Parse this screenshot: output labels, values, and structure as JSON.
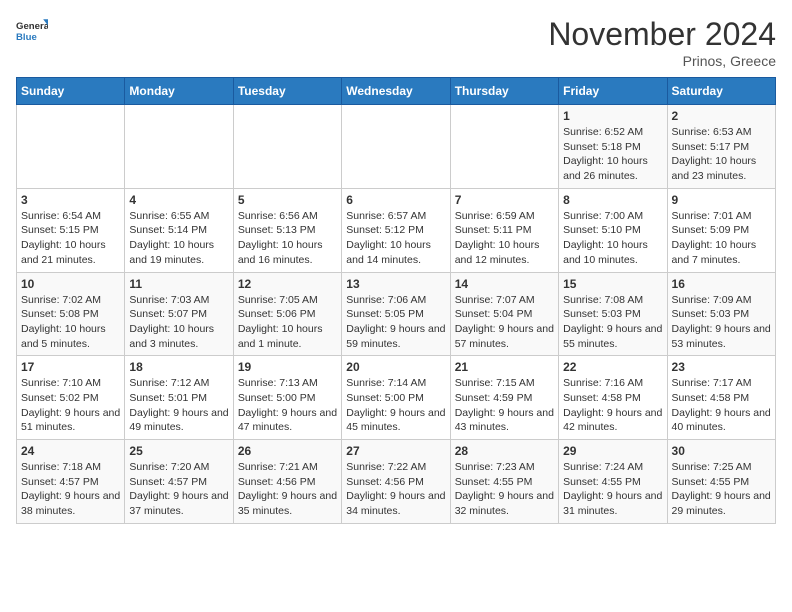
{
  "logo": {
    "line1": "General",
    "line2": "Blue"
  },
  "title": "November 2024",
  "subtitle": "Prinos, Greece",
  "days_of_week": [
    "Sunday",
    "Monday",
    "Tuesday",
    "Wednesday",
    "Thursday",
    "Friday",
    "Saturday"
  ],
  "weeks": [
    [
      {
        "day": "",
        "info": ""
      },
      {
        "day": "",
        "info": ""
      },
      {
        "day": "",
        "info": ""
      },
      {
        "day": "",
        "info": ""
      },
      {
        "day": "",
        "info": ""
      },
      {
        "day": "1",
        "info": "Sunrise: 6:52 AM\nSunset: 5:18 PM\nDaylight: 10 hours and 26 minutes."
      },
      {
        "day": "2",
        "info": "Sunrise: 6:53 AM\nSunset: 5:17 PM\nDaylight: 10 hours and 23 minutes."
      }
    ],
    [
      {
        "day": "3",
        "info": "Sunrise: 6:54 AM\nSunset: 5:15 PM\nDaylight: 10 hours and 21 minutes."
      },
      {
        "day": "4",
        "info": "Sunrise: 6:55 AM\nSunset: 5:14 PM\nDaylight: 10 hours and 19 minutes."
      },
      {
        "day": "5",
        "info": "Sunrise: 6:56 AM\nSunset: 5:13 PM\nDaylight: 10 hours and 16 minutes."
      },
      {
        "day": "6",
        "info": "Sunrise: 6:57 AM\nSunset: 5:12 PM\nDaylight: 10 hours and 14 minutes."
      },
      {
        "day": "7",
        "info": "Sunrise: 6:59 AM\nSunset: 5:11 PM\nDaylight: 10 hours and 12 minutes."
      },
      {
        "day": "8",
        "info": "Sunrise: 7:00 AM\nSunset: 5:10 PM\nDaylight: 10 hours and 10 minutes."
      },
      {
        "day": "9",
        "info": "Sunrise: 7:01 AM\nSunset: 5:09 PM\nDaylight: 10 hours and 7 minutes."
      }
    ],
    [
      {
        "day": "10",
        "info": "Sunrise: 7:02 AM\nSunset: 5:08 PM\nDaylight: 10 hours and 5 minutes."
      },
      {
        "day": "11",
        "info": "Sunrise: 7:03 AM\nSunset: 5:07 PM\nDaylight: 10 hours and 3 minutes."
      },
      {
        "day": "12",
        "info": "Sunrise: 7:05 AM\nSunset: 5:06 PM\nDaylight: 10 hours and 1 minute."
      },
      {
        "day": "13",
        "info": "Sunrise: 7:06 AM\nSunset: 5:05 PM\nDaylight: 9 hours and 59 minutes."
      },
      {
        "day": "14",
        "info": "Sunrise: 7:07 AM\nSunset: 5:04 PM\nDaylight: 9 hours and 57 minutes."
      },
      {
        "day": "15",
        "info": "Sunrise: 7:08 AM\nSunset: 5:03 PM\nDaylight: 9 hours and 55 minutes."
      },
      {
        "day": "16",
        "info": "Sunrise: 7:09 AM\nSunset: 5:03 PM\nDaylight: 9 hours and 53 minutes."
      }
    ],
    [
      {
        "day": "17",
        "info": "Sunrise: 7:10 AM\nSunset: 5:02 PM\nDaylight: 9 hours and 51 minutes."
      },
      {
        "day": "18",
        "info": "Sunrise: 7:12 AM\nSunset: 5:01 PM\nDaylight: 9 hours and 49 minutes."
      },
      {
        "day": "19",
        "info": "Sunrise: 7:13 AM\nSunset: 5:00 PM\nDaylight: 9 hours and 47 minutes."
      },
      {
        "day": "20",
        "info": "Sunrise: 7:14 AM\nSunset: 5:00 PM\nDaylight: 9 hours and 45 minutes."
      },
      {
        "day": "21",
        "info": "Sunrise: 7:15 AM\nSunset: 4:59 PM\nDaylight: 9 hours and 43 minutes."
      },
      {
        "day": "22",
        "info": "Sunrise: 7:16 AM\nSunset: 4:58 PM\nDaylight: 9 hours and 42 minutes."
      },
      {
        "day": "23",
        "info": "Sunrise: 7:17 AM\nSunset: 4:58 PM\nDaylight: 9 hours and 40 minutes."
      }
    ],
    [
      {
        "day": "24",
        "info": "Sunrise: 7:18 AM\nSunset: 4:57 PM\nDaylight: 9 hours and 38 minutes."
      },
      {
        "day": "25",
        "info": "Sunrise: 7:20 AM\nSunset: 4:57 PM\nDaylight: 9 hours and 37 minutes."
      },
      {
        "day": "26",
        "info": "Sunrise: 7:21 AM\nSunset: 4:56 PM\nDaylight: 9 hours and 35 minutes."
      },
      {
        "day": "27",
        "info": "Sunrise: 7:22 AM\nSunset: 4:56 PM\nDaylight: 9 hours and 34 minutes."
      },
      {
        "day": "28",
        "info": "Sunrise: 7:23 AM\nSunset: 4:55 PM\nDaylight: 9 hours and 32 minutes."
      },
      {
        "day": "29",
        "info": "Sunrise: 7:24 AM\nSunset: 4:55 PM\nDaylight: 9 hours and 31 minutes."
      },
      {
        "day": "30",
        "info": "Sunrise: 7:25 AM\nSunset: 4:55 PM\nDaylight: 9 hours and 29 minutes."
      }
    ]
  ]
}
